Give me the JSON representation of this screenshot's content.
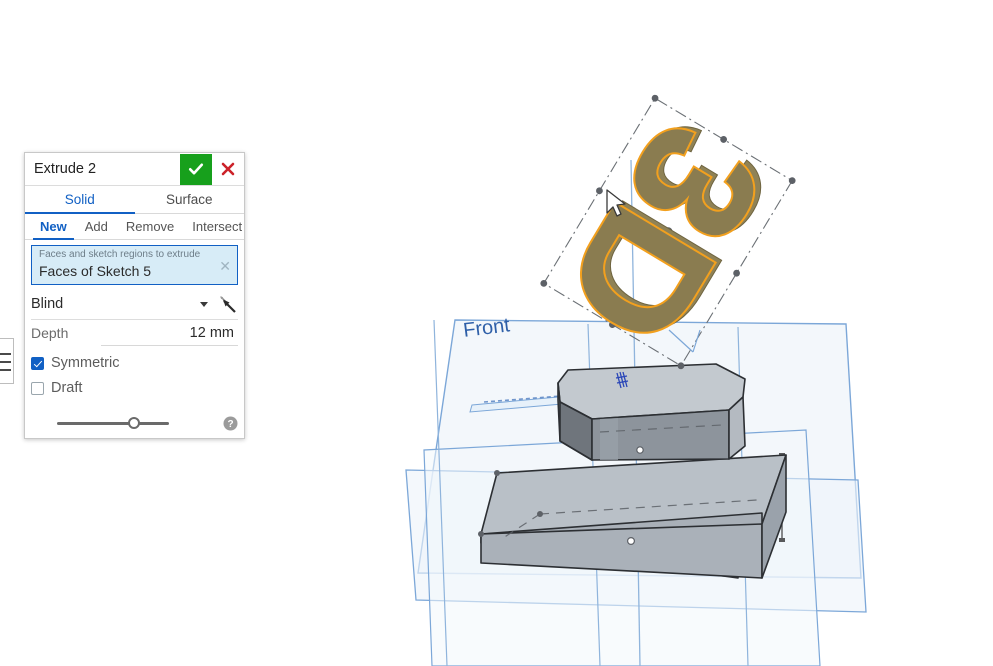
{
  "app": {
    "background_color": "#ffffff"
  },
  "edge_panel": {
    "icon": "hamburger-menu-icon"
  },
  "dialog": {
    "title": "Extrude 2",
    "accept_icon": "checkmark-icon",
    "accept_color": "#17a01c",
    "cancel_icon": "close-x-icon",
    "cancel_color": "#cc2229",
    "primary_tabs": [
      {
        "label": "Solid",
        "active": true
      },
      {
        "label": "Surface",
        "active": false
      }
    ],
    "secondary_tabs": [
      {
        "label": "New",
        "active": true
      },
      {
        "label": "Add",
        "active": false
      },
      {
        "label": "Remove",
        "active": false
      },
      {
        "label": "Intersect",
        "active": false
      }
    ],
    "selection": {
      "hint": "Faces and sketch regions to extrude",
      "value": "Faces of Sketch 5",
      "clear_icon": "close-x-icon",
      "highlight_color": "#1160c4",
      "fill_color": "#d7ecf7"
    },
    "end_condition": {
      "value": "Blind",
      "caret_icon": "chevron-down-icon",
      "flip_icon": "flip-direction-arrow-icon"
    },
    "depth": {
      "label": "Depth",
      "value": "12 mm"
    },
    "options": [
      {
        "label": "Symmetric",
        "checked": true
      },
      {
        "label": "Draft",
        "checked": false
      }
    ],
    "slider": {
      "position_percent": 63
    },
    "help_icon": "help-question-icon",
    "accent_color": "#1160c4"
  },
  "viewport": {
    "plane_label": "Front",
    "plane_label_color": "#2e5fa8",
    "plane_fill": "#eef4fa",
    "plane_stroke": "#7ca7d8",
    "selected_body": {
      "text": "3D",
      "face_color": "#8a7c50",
      "highlight_edge_color": "#f2a01e"
    },
    "solid_body": {
      "top_face_color": "#c3c9cf",
      "front_face_color": "#a9b0b8",
      "side_face_color": "#6f757c",
      "edge_color": "#2c2f33"
    },
    "cursor_icon": "arrow-cursor-icon"
  }
}
